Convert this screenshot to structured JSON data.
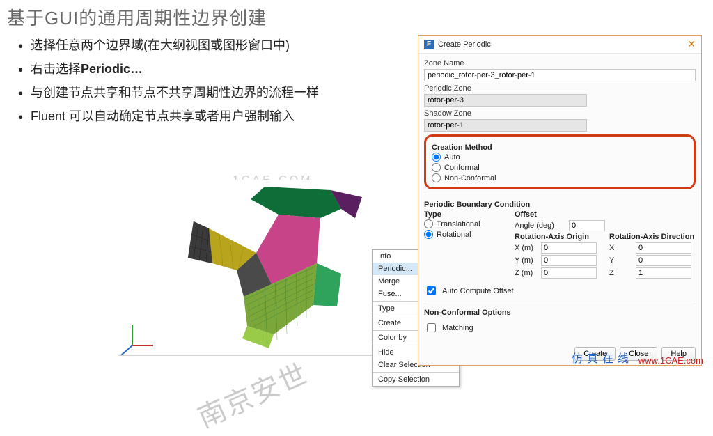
{
  "slide": {
    "title_pre": "基于",
    "title_gui": "GUI",
    "title_post": "的通用周期性边界创建",
    "bullets": {
      "b1": "选择任意两个边界域(在大纲视图或图形窗口中)",
      "b2_pre": "右击选择",
      "b2_b": "Periodic…",
      "b3": "与创建节点共享和节点不共享周期性边界的流程一样",
      "b4_pre": "Fluent ",
      "b4_rest": "可以自动确定节点共享或者用户强制输入"
    }
  },
  "watermark": {
    "main": "南京安世",
    "small": "1CAE.COM"
  },
  "context_menu": {
    "items": [
      {
        "label": "Info",
        "arrow": false,
        "highlight": false
      },
      {
        "label": "Periodic...",
        "arrow": false,
        "highlight": true
      },
      {
        "label": "Merge",
        "arrow": false,
        "highlight": false
      },
      {
        "label": "Fuse...",
        "arrow": false,
        "highlight": false
      },
      {
        "label": "Type",
        "arrow": true,
        "highlight": false,
        "sep_before": true
      },
      {
        "label": "Create",
        "arrow": true,
        "highlight": false,
        "sep_before": true
      },
      {
        "label": "Color by",
        "arrow": true,
        "highlight": false,
        "sep_before": true
      },
      {
        "label": "Hide",
        "arrow": true,
        "highlight": false,
        "sep_before": true
      },
      {
        "label": "Clear Selection",
        "arrow": false,
        "highlight": false
      },
      {
        "label": "Copy Selection",
        "arrow": false,
        "highlight": false,
        "sep_before": true
      }
    ]
  },
  "dialog": {
    "title": "Create Periodic",
    "zone_name_label": "Zone Name",
    "zone_name_value": "periodic_rotor-per-3_rotor-per-1",
    "periodic_zone_label": "Periodic Zone",
    "periodic_zone_value": "rotor-per-3",
    "shadow_zone_label": "Shadow Zone",
    "shadow_zone_value": "rotor-per-1",
    "creation_method": {
      "header": "Creation Method",
      "auto": "Auto",
      "conformal": "Conformal",
      "nonconformal": "Non-Conformal"
    },
    "pbc": {
      "header": "Periodic Boundary Condition",
      "type_header": "Type",
      "type_translational": "Translational",
      "type_rotational": "Rotational",
      "offset_header": "Offset",
      "angle_label": "Angle  (deg)",
      "angle_value": "0",
      "origin_header": "Rotation-Axis Origin",
      "direction_header": "Rotation-Axis Direction",
      "x_label": "X (m)",
      "y_label": "Y (m)",
      "z_label": "Z (m)",
      "x_label2": "X",
      "y_label2": "Y",
      "z_label2": "Z",
      "origin": {
        "x": "0",
        "y": "0",
        "z": "0"
      },
      "direction": {
        "x": "0",
        "y": "0",
        "z": "1"
      },
      "auto_compute": "Auto Compute Offset"
    },
    "nco": {
      "header": "Non-Conformal Options",
      "matching": "Matching"
    },
    "buttons": {
      "create": "Create",
      "close": "Close",
      "help": "Help"
    }
  },
  "footer": {
    "blue": "仿真在线",
    "red": "www.1CAE.com"
  }
}
